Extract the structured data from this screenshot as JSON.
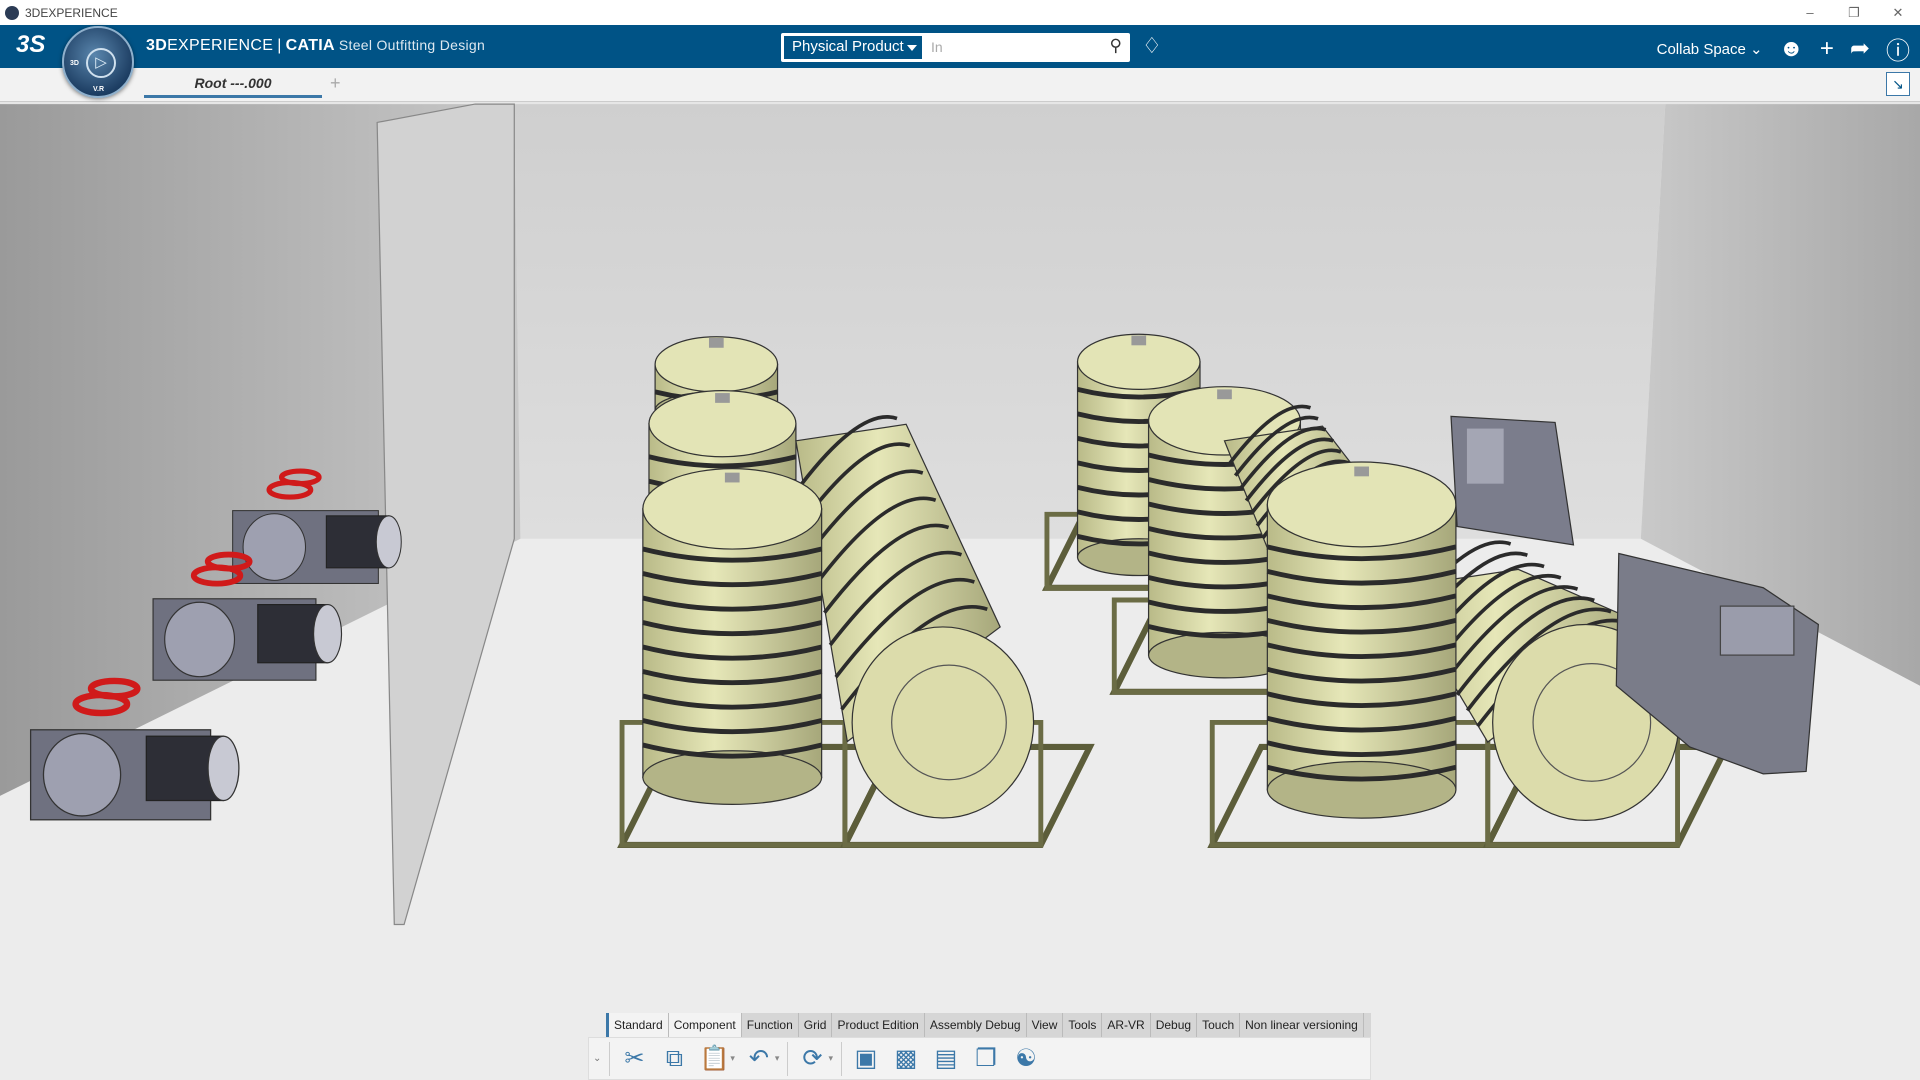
{
  "window": {
    "title": "3DEXPERIENCE",
    "controls": [
      "minimize",
      "restore",
      "close"
    ]
  },
  "header": {
    "brand": "3D",
    "brand_rest": "EXPERIENCE",
    "separator": "|",
    "app": "CATIA",
    "role": "Steel Outfitting Design",
    "compass_labels": {
      "left": "3D",
      "bottom": "V.R"
    },
    "search": {
      "scope": "Physical Product",
      "placeholder": "In"
    },
    "collab_space": "Collab Space",
    "icons": [
      "tag-icon",
      "user-icon",
      "plus-icon",
      "share-icon",
      "help-icon"
    ]
  },
  "tabs": {
    "document": "Root ---.000",
    "add": "+"
  },
  "toolbar": {
    "tabs": [
      "Standard",
      "Component",
      "Function",
      "Grid",
      "Product Edition",
      "Assembly Debug",
      "View",
      "Tools",
      "AR-VR",
      "Debug",
      "Touch",
      "Non linear versioning"
    ],
    "active_tab": "Component"
  },
  "colors": {
    "header": "#005386",
    "tank": "#d8d9a4",
    "accent": "#3c78a8"
  }
}
